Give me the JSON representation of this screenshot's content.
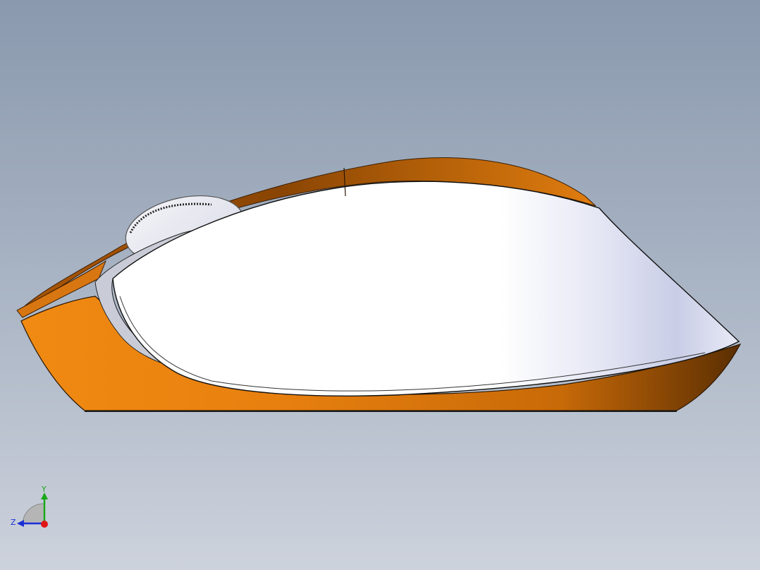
{
  "viewport": {
    "background_top": "#8a99ae",
    "background_bottom": "#cdd2dc"
  },
  "model": {
    "part": "computer-mouse",
    "view": "side",
    "body_color": "#e8800f",
    "shell_color": "#ffffff",
    "trim_color": "#c9ccd6"
  },
  "triad": {
    "y_label": "Y",
    "z_label": "Z",
    "y_color": "#1aa81a",
    "z_color": "#1a2fd6",
    "x_color": "#e01515"
  }
}
